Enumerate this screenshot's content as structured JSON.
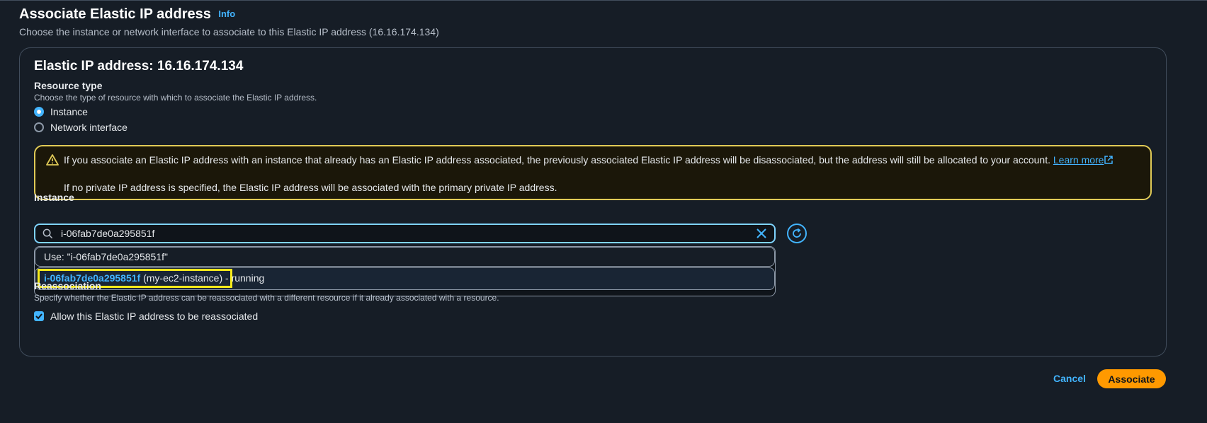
{
  "header": {
    "title": "Associate Elastic IP address",
    "info_label": "Info",
    "description": "Choose the instance or network interface to associate to this Elastic IP address (16.16.174.134)"
  },
  "panel": {
    "title": "Elastic IP address: 16.16.174.134",
    "resource_type": {
      "label": "Resource type",
      "description": "Choose the type of resource with which to associate the Elastic IP address.",
      "options": [
        {
          "label": "Instance",
          "selected": true
        },
        {
          "label": "Network interface",
          "selected": false
        }
      ]
    },
    "alert": {
      "line1": "If you associate an Elastic IP address with an instance that already has an Elastic IP address associated, the previously associated Elastic IP address will be disassociated, but the address will still be allocated to your account.",
      "learn_more": "Learn more",
      "line2": "If no private IP address is specified, the Elastic IP address will be associated with the primary private IP address."
    },
    "instance": {
      "label": "Instance",
      "search_value": "i-06fab7de0a295851f",
      "dropdown": {
        "use_option": "Use: \"i-06fab7de0a295851f\"",
        "result_id": "i-06fab7de0a295851f",
        "result_name": "(my-ec2-instance)",
        "result_state": " - running"
      }
    },
    "reassociation": {
      "label": "Reassociation",
      "description": "Specify whether the Elastic IP address can be reassociated with a different resource if it already associated with a resource.",
      "checkbox_label": "Allow this Elastic IP address to be reassociated",
      "checked": true
    }
  },
  "footer": {
    "cancel_label": "Cancel",
    "associate_label": "Associate"
  },
  "colors": {
    "background": "#161d26",
    "accent_blue": "#42b4ff",
    "warning_yellow": "#e0ca57",
    "primary_button": "#ff9900"
  }
}
